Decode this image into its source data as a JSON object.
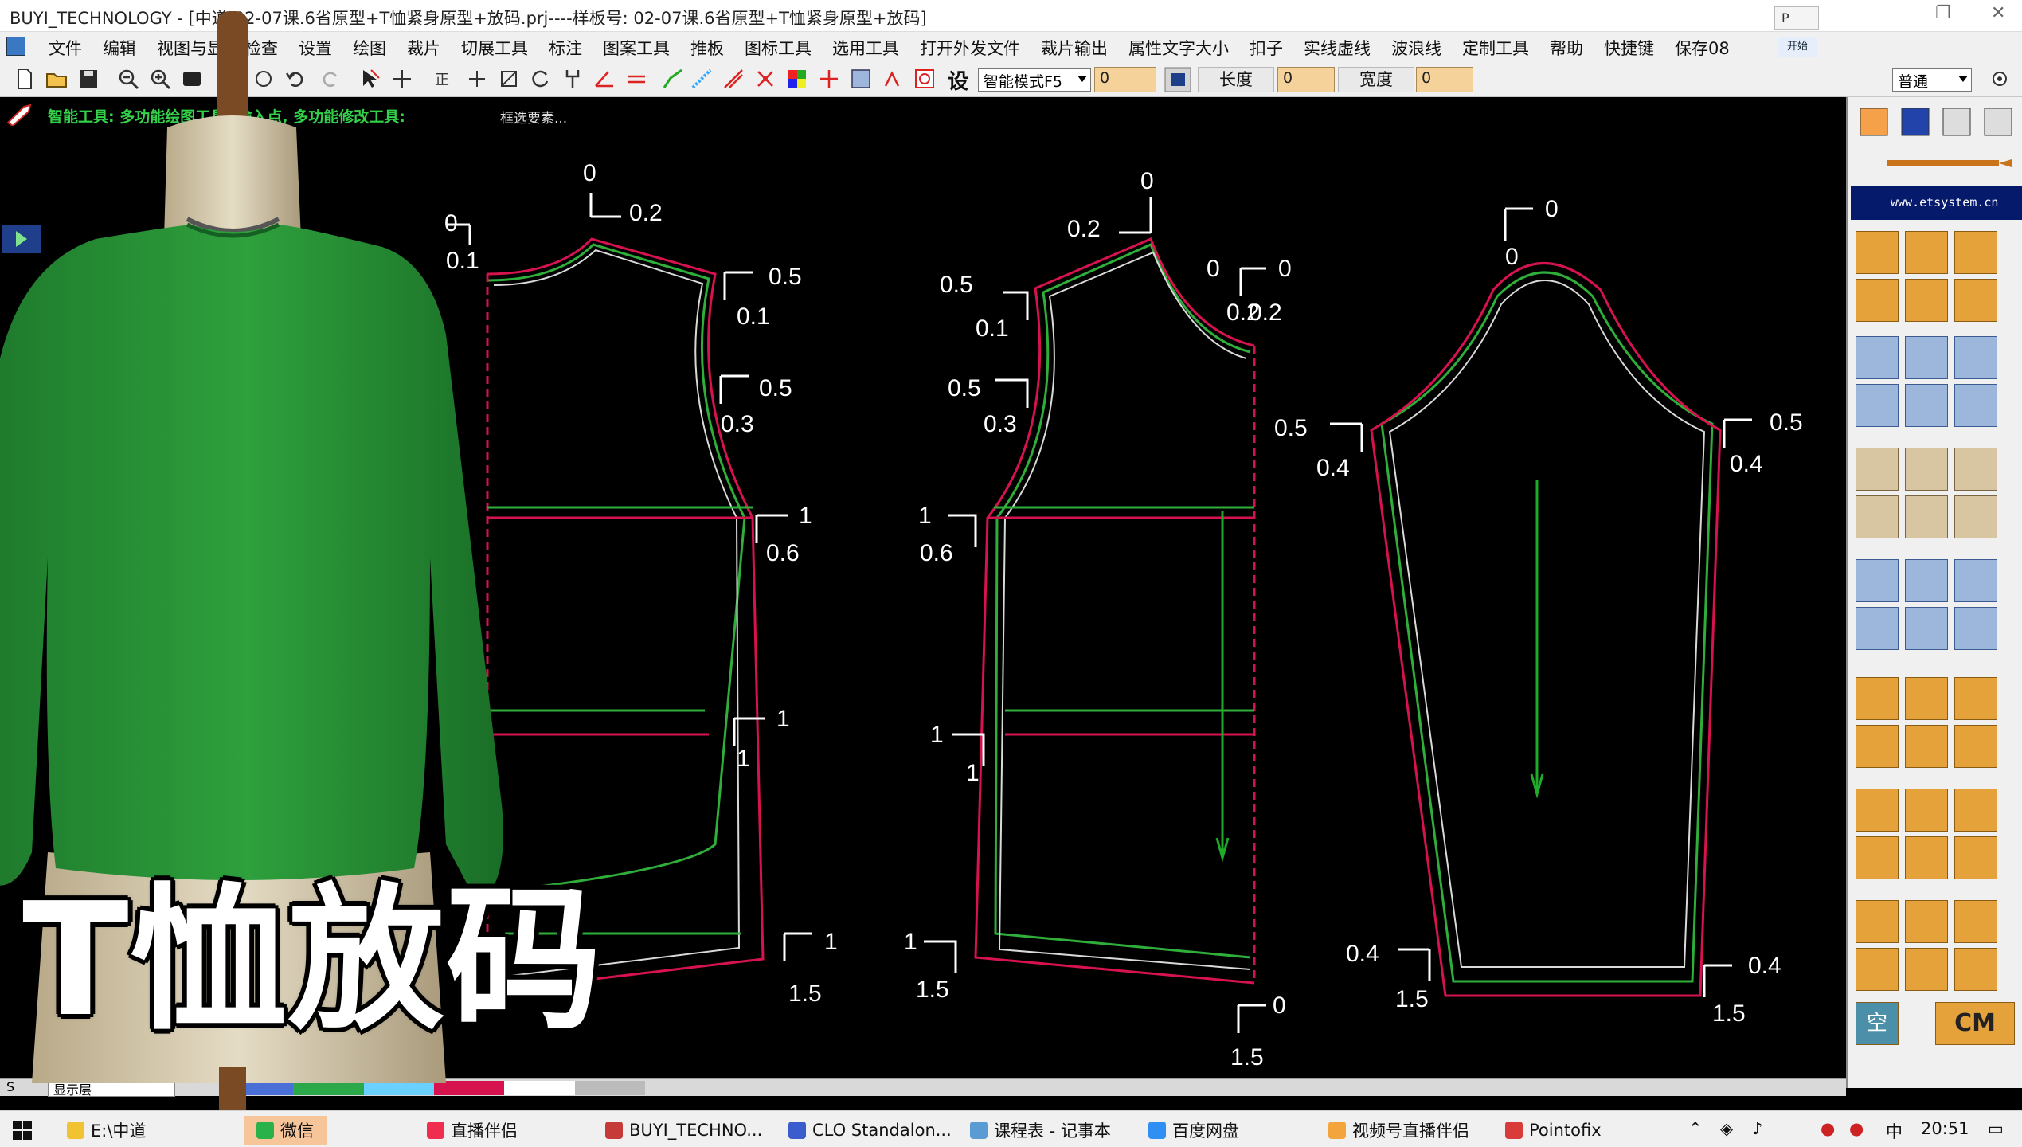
{
  "titlebar": {
    "title": "BUYI_TECHNOLOGY - [中道\\02-07课.6省原型+T恤紧身原型+放码.prj----样板号: 02-07课.6省原型+T恤紧身原型+放码]",
    "side_box": "P"
  },
  "menubar": {
    "items": [
      "文件",
      "编辑",
      "视图与显",
      "检查",
      "设置",
      "绘图",
      "裁片",
      "切展工具",
      "标注",
      "图案工具",
      "推板",
      "图标工具",
      "选用工具",
      "打开外发文件",
      "裁片输出",
      "属性文字大小",
      "扣子",
      "实线虚线",
      "波浪线",
      "定制工具",
      "帮助",
      "快捷键",
      "保存08"
    ],
    "start_button": "开始"
  },
  "toolbar": {
    "settings_glyph": "设",
    "mode_select": "智能模式F5",
    "field_1": "0",
    "length_label": "长度",
    "length_value": "0",
    "width_label": "宽度",
    "width_value": "0",
    "preset_select": "普通"
  },
  "status": {
    "message": "智能工具: 多功能绘图工具; 输入点, 多功能修改工具:",
    "hint": "框选要素..."
  },
  "palette": {
    "url": "www.etsystem.cn",
    "cm_label": "CM",
    "space_glyph": "空"
  },
  "pattern": {
    "back_labels": [
      "0",
      "0.2",
      "0",
      "0.1",
      "0.5",
      "0.1",
      "0.5",
      "0.3",
      "1",
      "0.6",
      "1",
      "1",
      "1",
      "1.5"
    ],
    "front_labels": [
      "0",
      "0.2",
      "0.5",
      "0.1",
      "0",
      "0",
      "0.2",
      "0.2",
      "0.5",
      "0.3",
      "1",
      "0.6",
      "1",
      "1",
      "1",
      "1.5",
      "0",
      "1.5"
    ],
    "sleeve_labels": [
      "0",
      "0",
      "0.5",
      "0.4",
      "0.5",
      "0.4",
      "0.4",
      "1.5",
      "0.4",
      "1.5"
    ],
    "colors": {
      "seam_line": "#2fae3a",
      "cut_line": "#d6134f",
      "stitch_line": "#d9d9d9",
      "grain_arrow": "#1faa2a"
    }
  },
  "overlay": {
    "title": "T恤放码"
  },
  "layerbar": {
    "s_label": "S",
    "layer_name": "显示层"
  },
  "taskbar": {
    "items": [
      "E:\\中道",
      "微信",
      "直播伴侣",
      "BUYI_TECHNO...",
      "CLO Standalon...",
      "课程表 - 记事本",
      "百度网盘",
      "视频号直播伴侣",
      "Pointofix"
    ],
    "ime": "中",
    "clock": "20:51"
  }
}
